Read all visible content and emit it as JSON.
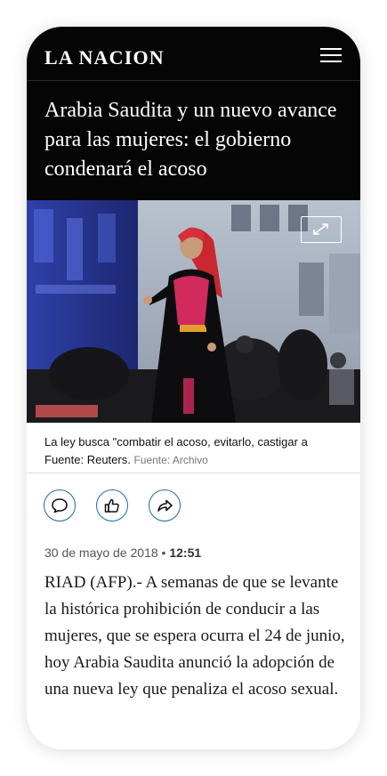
{
  "header": {
    "logo": "LA NACION"
  },
  "article": {
    "headline": "Arabia Saudita y un nuevo avance para las mujeres: el gobierno condenará el acoso",
    "caption": "La ley busca \"combatir el acoso, evitarlo, castigar a",
    "credit": "Fuente: Reuters.",
    "source_label": "Fuente: Archivo",
    "date": "30 de mayo de 2018",
    "separator": "•",
    "time": "12:51",
    "body": "RIAD (AFP).- A semanas de que se levante la histórica prohibición de conducir a las mujeres, que se espera ocurra el 24 de junio, hoy Arabia Saudita anunció la adopción de una nueva ley que penaliza el acoso sexual."
  },
  "icons": {
    "menu": "hamburger-menu-icon",
    "expand": "expand-arrows-icon",
    "comment": "comment-bubble-icon",
    "like": "thumbs-up-icon",
    "share": "share-arrow-icon"
  },
  "colors": {
    "header_bg": "#050505",
    "accent": "#1a6e9a"
  }
}
